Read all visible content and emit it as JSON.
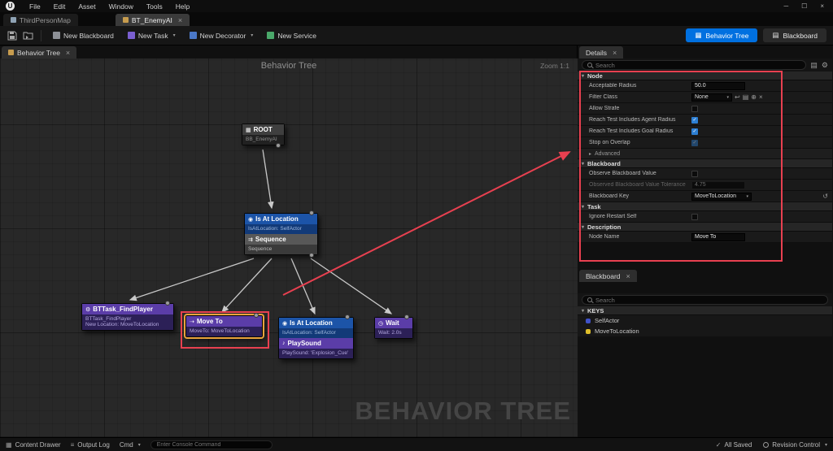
{
  "colors": {
    "accent_blue": "#0070e0",
    "annotation_red": "#e84050",
    "selection_yellow": "#e8a33d",
    "key_object_color": "#4052c8",
    "key_vector_color": "#e0bf2a"
  },
  "icons": {
    "logo": "U",
    "minimize": "─",
    "maximize": "☐",
    "close": "×",
    "expanded": "▾",
    "collapsed": "▸",
    "check": "✓",
    "reset": "↺",
    "use_selected": "↩",
    "browse": "▤",
    "add": "⊕",
    "gear": "⚙",
    "grid": "▦",
    "list": "≡",
    "root": "▦",
    "sequence": "⇉",
    "location": "◉",
    "task": "⚙",
    "move": "⇢",
    "sound": "♪",
    "wait": "◷"
  },
  "menu_bar": {
    "items": [
      "File",
      "Edit",
      "Asset",
      "Window",
      "Tools",
      "Help"
    ]
  },
  "asset_tabs": {
    "map": {
      "label": "ThirdPersonMap"
    },
    "bt": {
      "label": "BT_EnemyAI"
    }
  },
  "toolbar": {
    "new_blackboard": "New Blackboard",
    "new_task": "New Task",
    "new_decorator": "New Decorator",
    "new_service": "New Service",
    "behavior_tree_mode": "Behavior Tree",
    "blackboard_mode": "Blackboard"
  },
  "graph": {
    "panel_tab_label": "Behavior Tree",
    "title": "Behavior Tree",
    "zoom_label": "Zoom 1:1",
    "watermark": "BEHAVIOR TREE",
    "nodes": {
      "root": {
        "title": "ROOT",
        "subtitle": "BB_EnemyAI"
      },
      "decorator_top": {
        "title": "Is At Location",
        "subtitle": "IsAtLocation: SelfActor"
      },
      "sequence": {
        "title": "Sequence",
        "subtitle": "Sequence"
      },
      "find_player": {
        "title": "BTTask_FindPlayer",
        "line1": "BTTask_FindPlayer",
        "line2": "New Location: MoveToLocation"
      },
      "move_to": {
        "title": "Move To",
        "subtitle": "MoveTo: MoveToLocation"
      },
      "decorator_child": {
        "title": "Is At Location",
        "subtitle": "IsAtLocation: SelfActor"
      },
      "play_sound": {
        "title": "PlaySound",
        "subtitle": "PlaySound: 'Explosion_Cue'"
      },
      "wait": {
        "title": "Wait",
        "subtitle": "Wait: 2.0s"
      }
    }
  },
  "details": {
    "tab_label": "Details",
    "search_placeholder": "Search",
    "sections": {
      "node": "Node",
      "blackboard": "Blackboard",
      "task": "Task",
      "description": "Description"
    },
    "rows": {
      "acceptable_radius": {
        "label": "Acceptable Radius",
        "value": "50.0"
      },
      "filter_class": {
        "label": "Filter Class",
        "value": "None"
      },
      "allow_strafe": {
        "label": "Allow Strafe"
      },
      "reach_agent_radius": {
        "label": "Reach Test Includes Agent Radius"
      },
      "reach_goal_radius": {
        "label": "Reach Test Includes Goal Radius"
      },
      "stop_on_overlap": {
        "label": "Stop on Overlap"
      },
      "advanced": {
        "label": "Advanced"
      },
      "observe_blackboard_value": {
        "label": "Observe Blackboard Value"
      },
      "observed_tolerance": {
        "label": "Observed Blackboard Value Tolerance",
        "value": "4.75"
      },
      "blackboard_key": {
        "label": "Blackboard Key",
        "value": "MoveToLocation"
      },
      "ignore_restart_self": {
        "label": "Ignore Restart Self"
      },
      "node_name": {
        "label": "Node Name",
        "value": "Move To"
      }
    }
  },
  "blackboard": {
    "tab_label": "Blackboard",
    "search_placeholder": "Search",
    "keys_header": "KEYS",
    "keys": [
      {
        "name": "SelfActor",
        "color": "#4052c8"
      },
      {
        "name": "MoveToLocation",
        "color": "#e0bf2a"
      }
    ]
  },
  "status_bar": {
    "content_drawer": "Content Drawer",
    "output_log": "Output Log",
    "cmd": "Cmd",
    "console_placeholder": "Enter Console Command",
    "all_saved": "All Saved",
    "revision_control": "Revision Control"
  }
}
